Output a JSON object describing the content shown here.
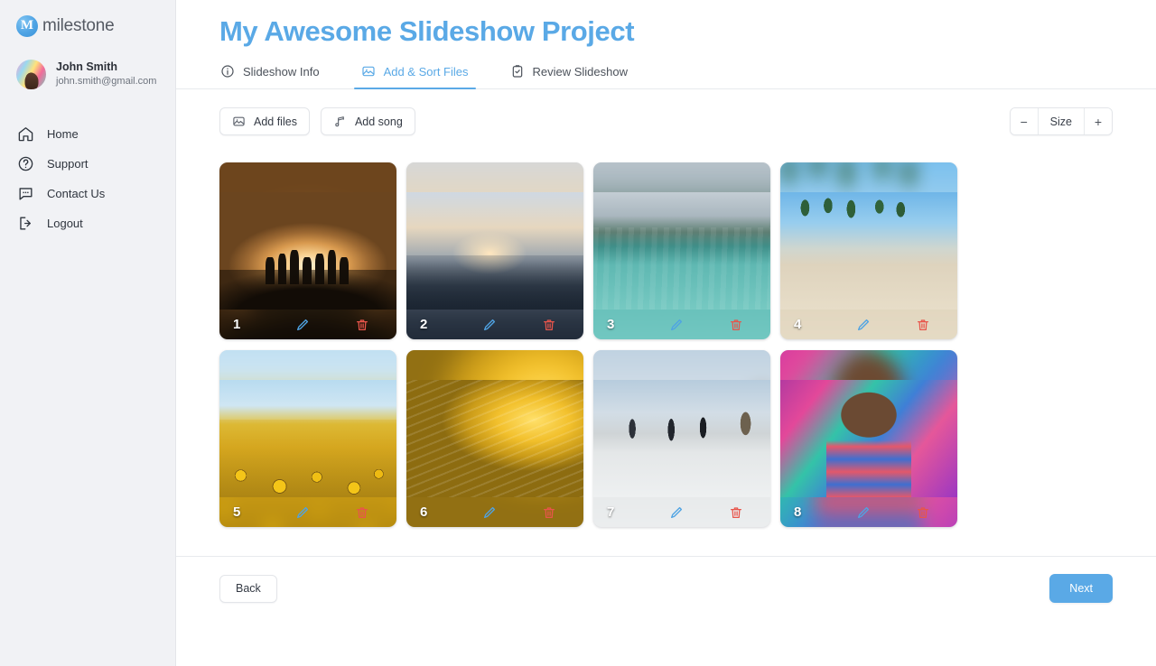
{
  "brand": {
    "mark": "M",
    "name": "milestone",
    "accent": "#5aa9e6"
  },
  "user": {
    "name": "John Smith",
    "email": "john.smith@gmail.com",
    "avatar_icon": "user-avatar-photo"
  },
  "sidebar": {
    "items": [
      {
        "label": "Home",
        "icon": "home-icon"
      },
      {
        "label": "Support",
        "icon": "question-circle-icon"
      },
      {
        "label": "Contact Us",
        "icon": "chat-bubble-icon"
      },
      {
        "label": "Logout",
        "icon": "logout-icon"
      }
    ]
  },
  "header": {
    "title": "My Awesome Slideshow Project"
  },
  "tabs": [
    {
      "label": "Slideshow Info",
      "icon": "info-circle-icon",
      "active": false
    },
    {
      "label": "Add & Sort Files",
      "icon": "image-icon",
      "active": true
    },
    {
      "label": "Review Slideshow",
      "icon": "clipboard-check-icon",
      "active": false
    }
  ],
  "toolbar": {
    "add_files_label": "Add files",
    "add_files_icon": "image-icon",
    "add_song_label": "Add song",
    "add_song_icon": "music-note-icon",
    "size_minus_label": "−",
    "size_label": "Size",
    "size_plus_label": "+"
  },
  "grid": {
    "edit_icon": "pencil-icon",
    "delete_icon": "trash-icon",
    "cards": [
      {
        "number": "1",
        "art": "art-sunset",
        "alt": "Silhouettes of friends cheering at sunset"
      },
      {
        "number": "2",
        "art": "art-friends",
        "alt": "Three friends raising arms at sunset on a rooftop"
      },
      {
        "number": "3",
        "art": "art-pier",
        "alt": "People jumping off a pier into tropical water"
      },
      {
        "number": "4",
        "art": "art-beach",
        "alt": "Friends playing spikeball on a palm-lined beach"
      },
      {
        "number": "5",
        "art": "art-sunflower",
        "alt": "Three women laughing in a sunflower field"
      },
      {
        "number": "6",
        "art": "art-sprinkler",
        "alt": "Boy running through a sprinkler in golden light"
      },
      {
        "number": "7",
        "art": "art-winter",
        "alt": "Three people jumping in the snow"
      },
      {
        "number": "8",
        "art": "art-graffiti",
        "alt": "Man in striped shirt in front of graffiti wall"
      }
    ]
  },
  "footer": {
    "back_label": "Back",
    "next_label": "Next"
  }
}
